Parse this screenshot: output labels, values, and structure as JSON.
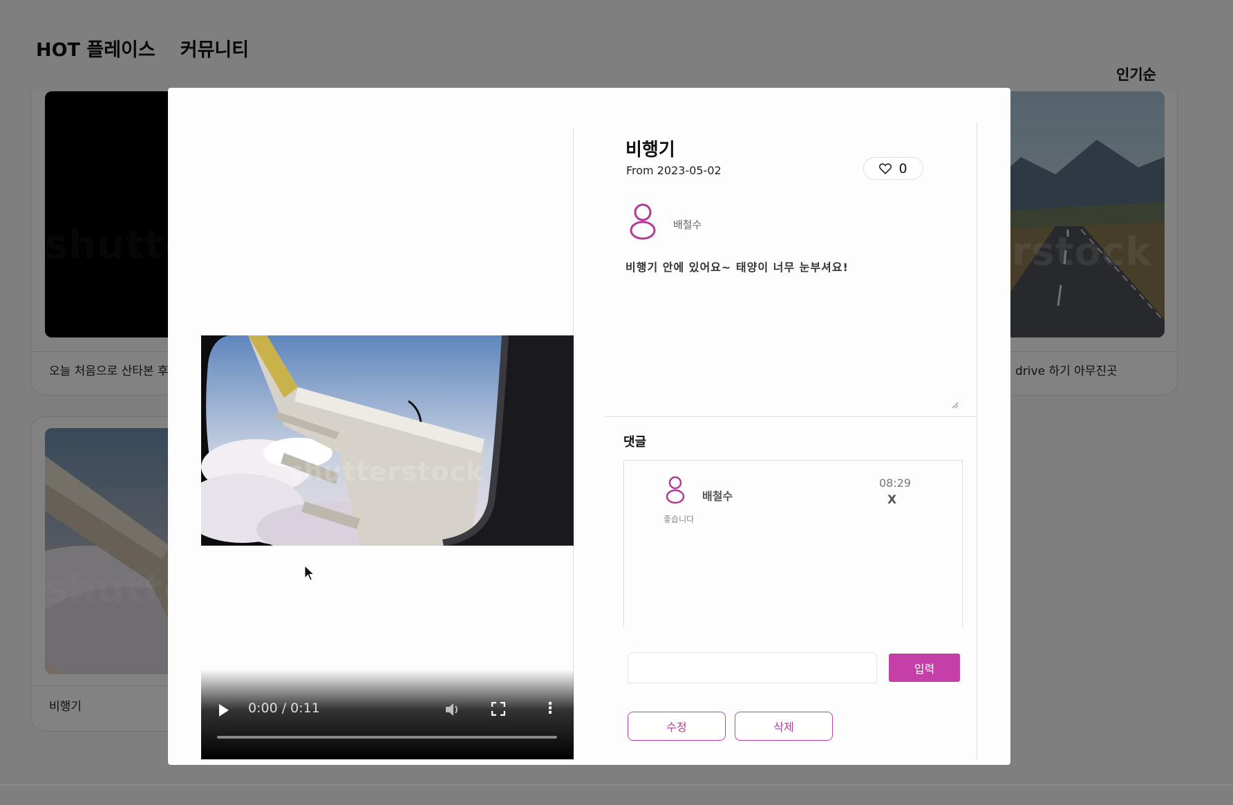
{
  "nav": {
    "hot_places": "HOT 플레이스",
    "community": "커뮤니티"
  },
  "sort": {
    "label": "인기순"
  },
  "cards": [
    {
      "caption": "오늘 처음으로 산타본 후",
      "watermark": "shutte"
    },
    {
      "caption": "drive 하기 아무진곳",
      "watermark": "terstock"
    },
    {
      "caption": "비행기",
      "watermark": "shutte"
    }
  ],
  "modal": {
    "title": "비행기",
    "date": "From 2023-05-02",
    "likes": "0",
    "author": "배철수",
    "content": "비행기 안에 있어요~ 태양이 너무 눈부셔요!",
    "video": {
      "time": "0:00 / 0:11",
      "progress": 0,
      "watermark": "shutterstock"
    },
    "comments": {
      "label": "댓글",
      "items": [
        {
          "author": "배철수",
          "time": "08:29",
          "delete": "X",
          "text": "좋습니다"
        }
      ],
      "input_value": "",
      "submit_label": "입력"
    },
    "actions": {
      "edit_label": "수정",
      "delete_label": "삭제"
    }
  },
  "colors": {
    "accent": "#c43fa8",
    "overlay": "rgba(0,0,0,0.49)"
  }
}
